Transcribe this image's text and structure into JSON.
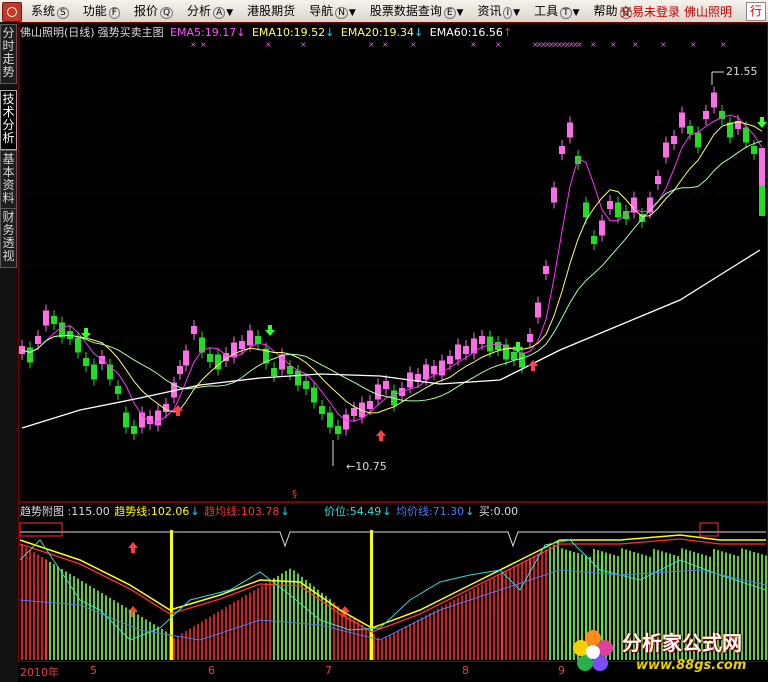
{
  "menubar": {
    "items": [
      {
        "label": "系统",
        "key": "S"
      },
      {
        "label": "功能",
        "key": "F"
      },
      {
        "label": "报价",
        "key": "Q"
      },
      {
        "label": "分析",
        "key": "A"
      },
      {
        "label": "港股期货",
        "key": ""
      },
      {
        "label": "导航",
        "key": "N"
      },
      {
        "label": "股票数据查询",
        "key": "E"
      },
      {
        "label": "资讯",
        "key": "I"
      },
      {
        "label": "工具",
        "key": "T"
      },
      {
        "label": "帮助",
        "key": "H"
      }
    ],
    "status_login": "交易未登录",
    "status_user": "佛山照明",
    "row_button": "行"
  },
  "sidebar": {
    "tabs": [
      "分时走势",
      "技术分析",
      "基本资料",
      "财务透视"
    ],
    "active_index": 1
  },
  "main_legend": {
    "title": "佛山照明(日线)",
    "formula": "强势买卖主图",
    "ema5": "EMA5:19.17",
    "ema10": "EMA10:19.52",
    "ema20": "EMA20:19.34",
    "ema60": "EMA60:16.56",
    "down_arrow": "↓",
    "up_arrow": "↑"
  },
  "sub_legend": {
    "title": "趋势附图 :115.00",
    "trend_line": "趋势线:102.06",
    "trend_avg": "趋均线:103.78",
    "price_level": "价位:54.49",
    "avg_price_line": "均价线:71.30",
    "buy": "买:0.00",
    "down_arrow": "↓"
  },
  "annotations": {
    "high_price": "21.55",
    "low_price": "10.75",
    "marker": "§"
  },
  "time_axis": {
    "labels": [
      "2010年",
      "5",
      "6",
      "7",
      "8",
      "9"
    ]
  },
  "watermark": {
    "title": "分析家公式网",
    "url": "www.88gs.com"
  },
  "colors": {
    "up_candle": "#ff6ee8",
    "down_candle": "#22dd22",
    "ema5": "#ff33ff",
    "ema10": "#ffff66",
    "ema20": "#aaffaa",
    "ema60": "#ffffff",
    "title_pink": "#ff55ff",
    "accent_red": "#ff3030",
    "accent_yellow": "#ffff00",
    "accent_cyan": "#33dddd",
    "accent_blue": "#4b7bff",
    "menubar_bg": "#ece9e0"
  }
}
